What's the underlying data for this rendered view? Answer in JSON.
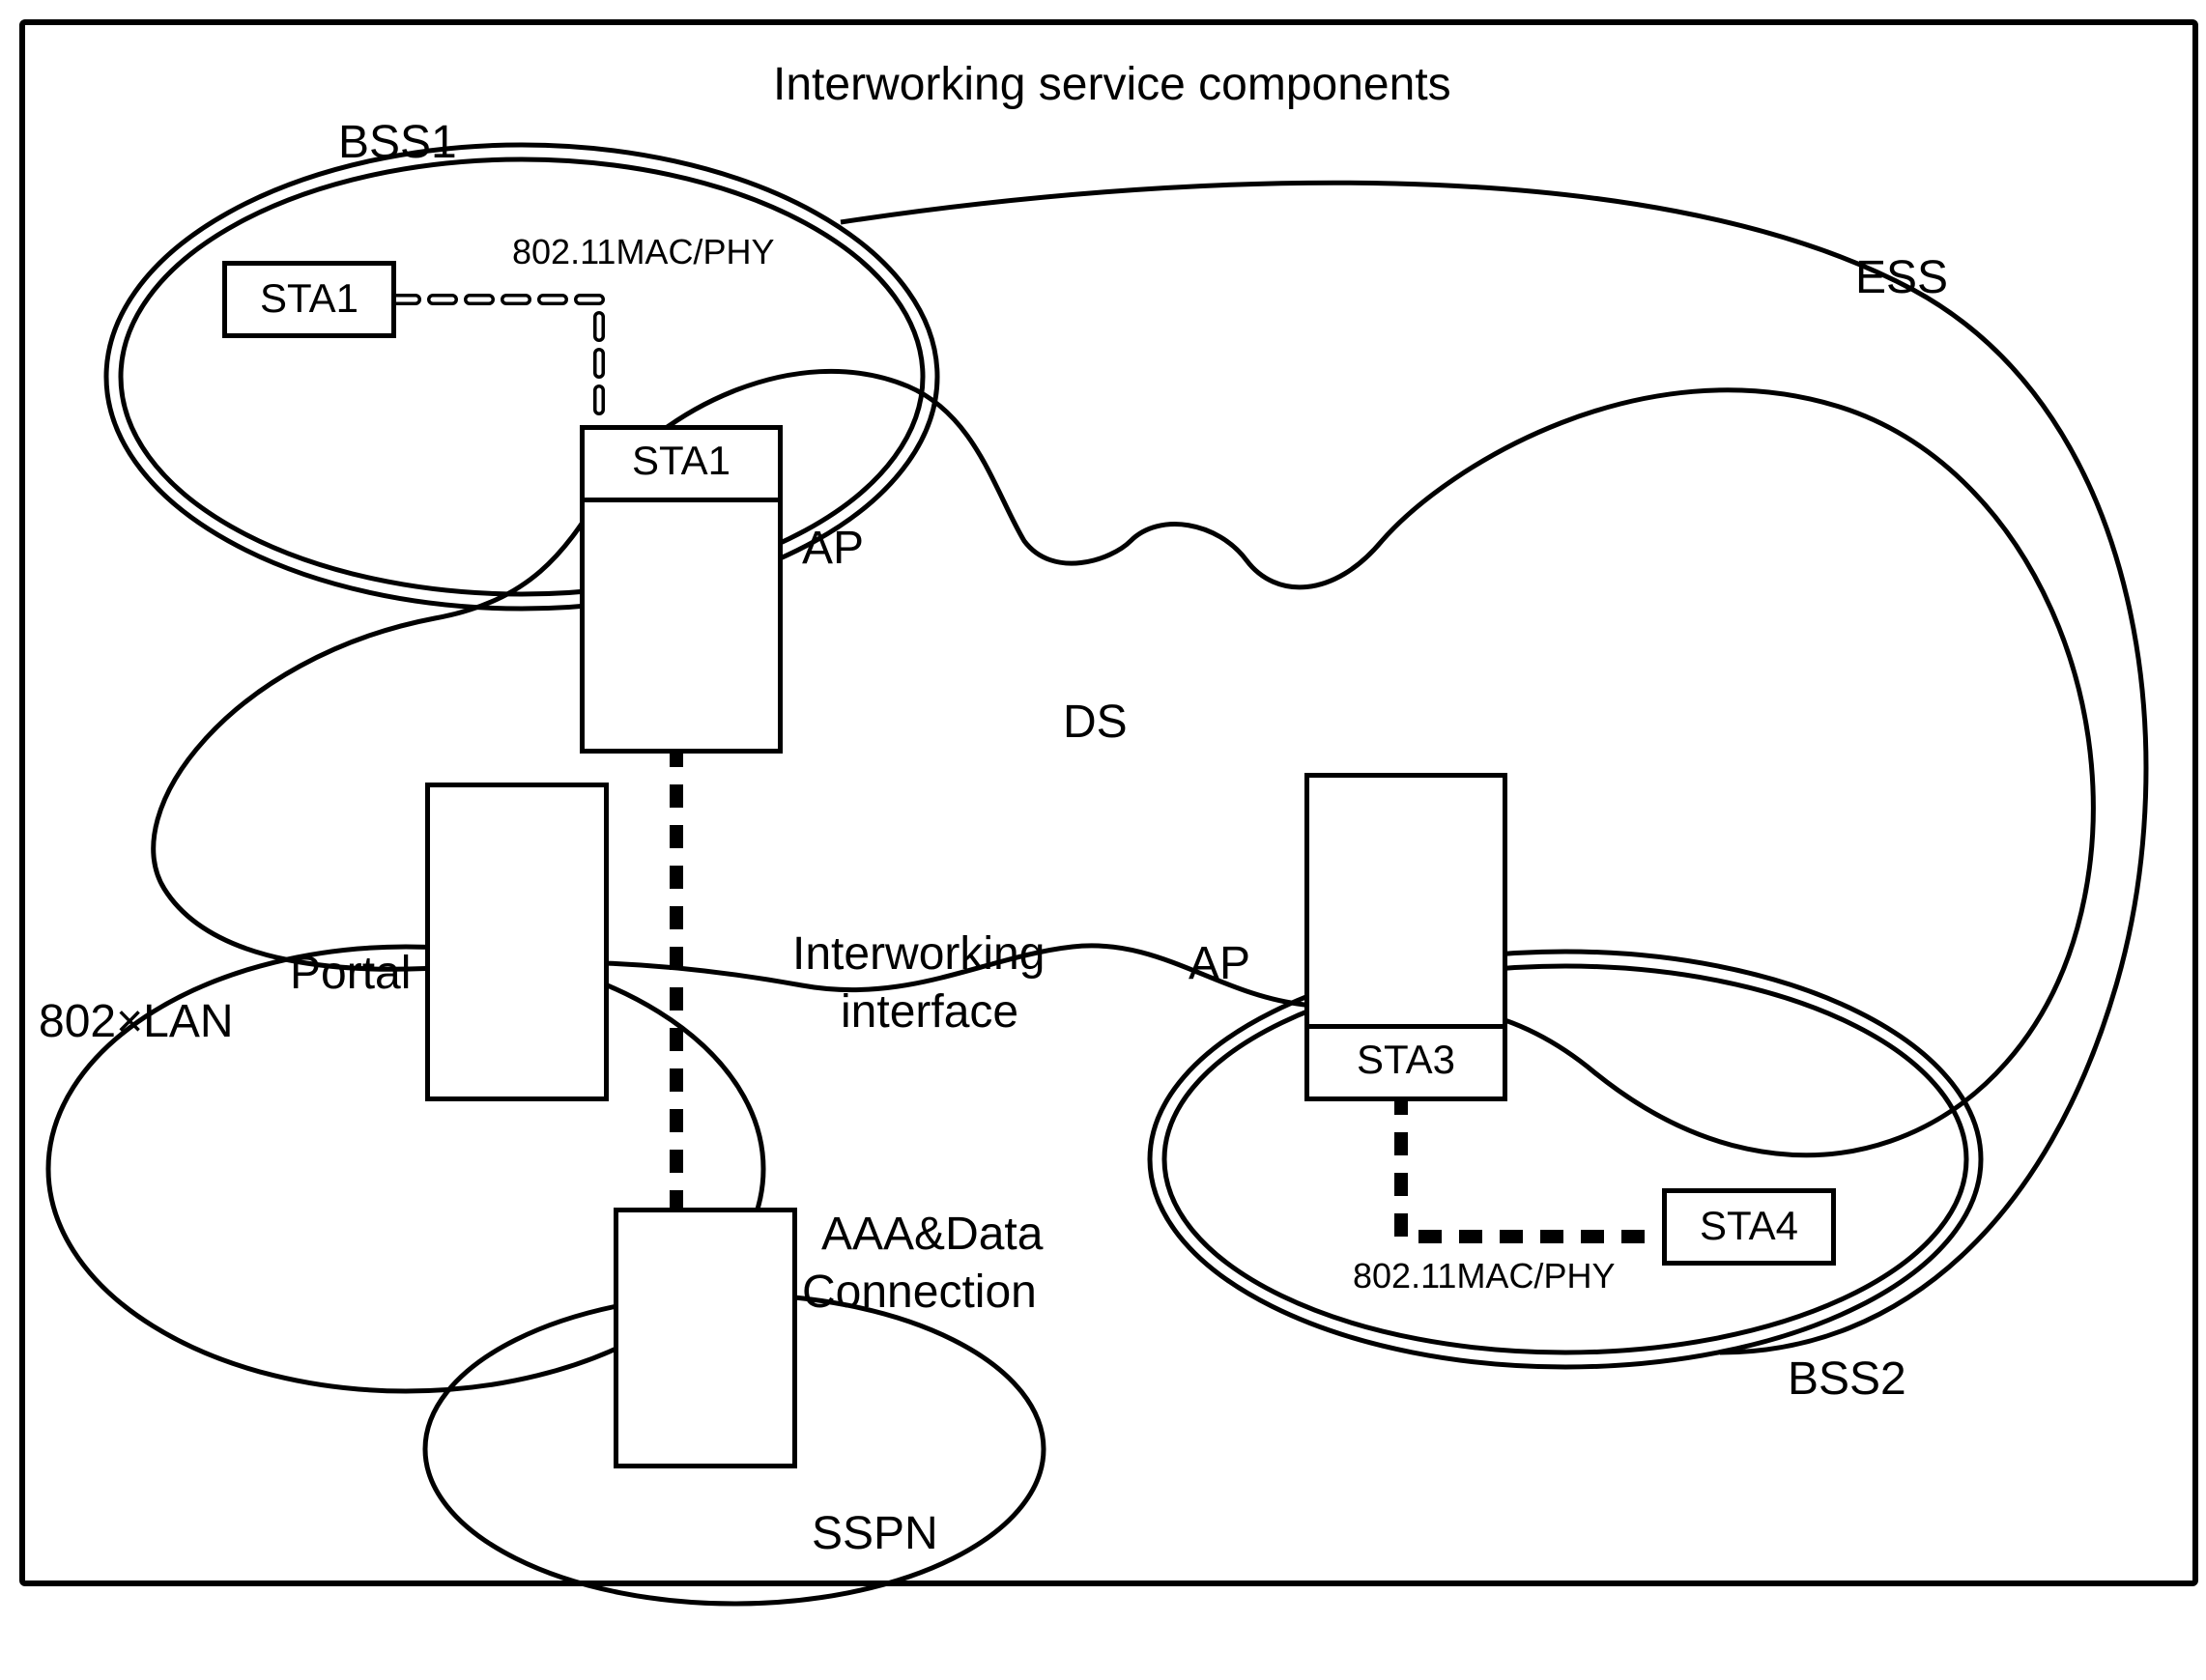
{
  "title": "Interworking service components",
  "labels": {
    "bss1": "BSS1",
    "bss2": "BSS2",
    "ess": "ESS",
    "ds": "DS",
    "ap1": "AP",
    "ap2": "AP",
    "portal": "Portal",
    "lan": "802×LAN",
    "sspn": "SSPN",
    "interworking_line1": "Interworking",
    "interworking_line2": "interface",
    "aaa_line1": "AAA&Data",
    "aaa_line2": "Connection",
    "macphy1": "802.11MAC/PHY",
    "macphy2": "802.11MAC/PHY"
  },
  "stations": {
    "sta1a": "STA1",
    "sta1b": "STA1",
    "sta3": "STA3",
    "sta4": "STA4"
  }
}
